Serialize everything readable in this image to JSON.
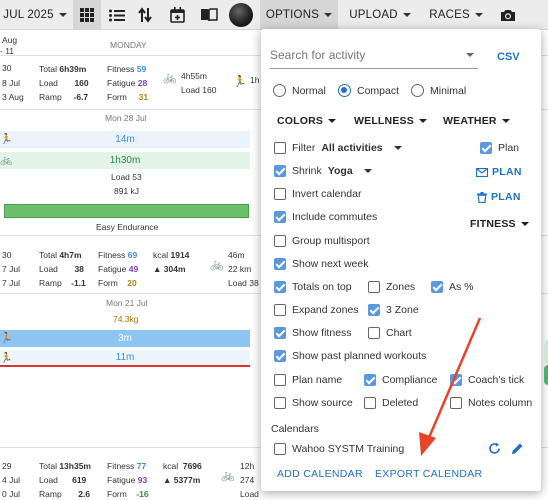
{
  "topbar": {
    "month_label": "JUL 2025",
    "menus": [
      {
        "label": "OPTIONS",
        "active": true
      },
      {
        "label": "UPLOAD"
      },
      {
        "label": "RACES"
      }
    ],
    "icons": [
      "calendar-grid-icon",
      "list-icon",
      "sort-icon",
      "calendar-add-icon",
      "book-icon",
      "avatar",
      "camera-icon"
    ]
  },
  "calendar": {
    "week1": {
      "left": [
        "Aug",
        "- 11",
        "30",
        "8 Jul",
        "3 Aug"
      ],
      "day_name": "MONDAY",
      "total": "Total",
      "total_val": "6h39m",
      "load": "Load",
      "load_val": "160",
      "ramp": "Ramp",
      "ramp_val": "-6.7",
      "fitness": "Fitness",
      "fitness_val": "59",
      "fatigue": "Fatigue",
      "fatigue_val": "28",
      "form": "Form",
      "form_val": "31",
      "ride_time": "4h55m",
      "ride_load": "Load 160",
      "run_time": "1h"
    },
    "day1": {
      "date": "Mon 28 Jul",
      "run_bar": "14m",
      "ride_bar": "1h30m",
      "load": "Load 53",
      "kj": "891 kJ",
      "workout": "Easy Endurance"
    },
    "week2": {
      "left": [
        "30",
        "7 Jul",
        "7 Jul"
      ],
      "total_val": "4h7m",
      "load_val": "38",
      "ramp_val": "-1.1",
      "fitness_val": "69",
      "fatigue_val": "49",
      "form_val": "20",
      "kcal": "kcal",
      "kcal_val": "1914",
      "elev": "304m",
      "ride_time": "46m",
      "ride_dist": "22 km",
      "ride_load": "Load 38"
    },
    "day2": {
      "date": "Mon 21 Jul",
      "weight": "74.3kg",
      "swim_bar": "3m",
      "run_bar": "11m"
    },
    "week3": {
      "left": [
        "29",
        "4 Jul",
        "0 Jul"
      ],
      "total_val": "13h35m",
      "load_val": "619",
      "ramp_val": "2.6",
      "fitness_val": "77",
      "fatigue_val": "93",
      "form_val": "-16",
      "kcal_val": "7696",
      "elev": "5377m",
      "ride_time": "12h",
      "ride_dist": "274",
      "ride_load": "Load"
    }
  },
  "options": {
    "search_placeholder": "Search for activity",
    "csv": "CSV",
    "view_modes": [
      {
        "label": "Normal",
        "selected": false
      },
      {
        "label": "Compact",
        "selected": true
      },
      {
        "label": "Minimal",
        "selected": false
      }
    ],
    "dropdowns": {
      "colors": "COLORS",
      "wellness": "WELLNESS",
      "weather": "WEATHER",
      "fitness": "FITNESS"
    },
    "filter": {
      "label": "Filter",
      "value": "All activities",
      "checked": false
    },
    "shrink": {
      "label": "Shrink",
      "value": "Yoga",
      "checked": true
    },
    "plan_check": {
      "label": "Plan",
      "checked": true
    },
    "plan_mail": "PLAN",
    "plan_delete": "PLAN",
    "checks": [
      {
        "label": "Invert calendar",
        "checked": false
      },
      {
        "label": "Include commutes",
        "checked": true
      },
      {
        "label": "Group multisport",
        "checked": false
      },
      {
        "label": "Show next week",
        "checked": true
      },
      {
        "label": "Totals on top",
        "checked": true
      },
      {
        "label": "Zones",
        "checked": false
      },
      {
        "label": "As %",
        "checked": true
      },
      {
        "label": "Expand zones",
        "checked": false
      },
      {
        "label": "3 Zone",
        "checked": true
      },
      {
        "label": "Show fitness",
        "checked": true
      },
      {
        "label": "Chart",
        "checked": false
      },
      {
        "label": "Show past planned workouts",
        "checked": true
      },
      {
        "label": "Plan name",
        "checked": false
      },
      {
        "label": "Compliance",
        "checked": true
      },
      {
        "label": "Coach's tick",
        "checked": true
      },
      {
        "label": "Show source",
        "checked": false
      },
      {
        "label": "Deleted",
        "checked": false
      },
      {
        "label": "Notes column",
        "checked": false
      }
    ],
    "calendars_heading": "Calendars",
    "calendar_entry": {
      "label": "Wahoo SYSTM Training",
      "checked": false
    },
    "add_calendar": "ADD CALENDAR",
    "export_calendar": "EXPORT CALENDAR"
  },
  "colors": {
    "accent": "#1e70c8",
    "checkbox": "#5a98e0",
    "arrow": "#e8442a"
  }
}
